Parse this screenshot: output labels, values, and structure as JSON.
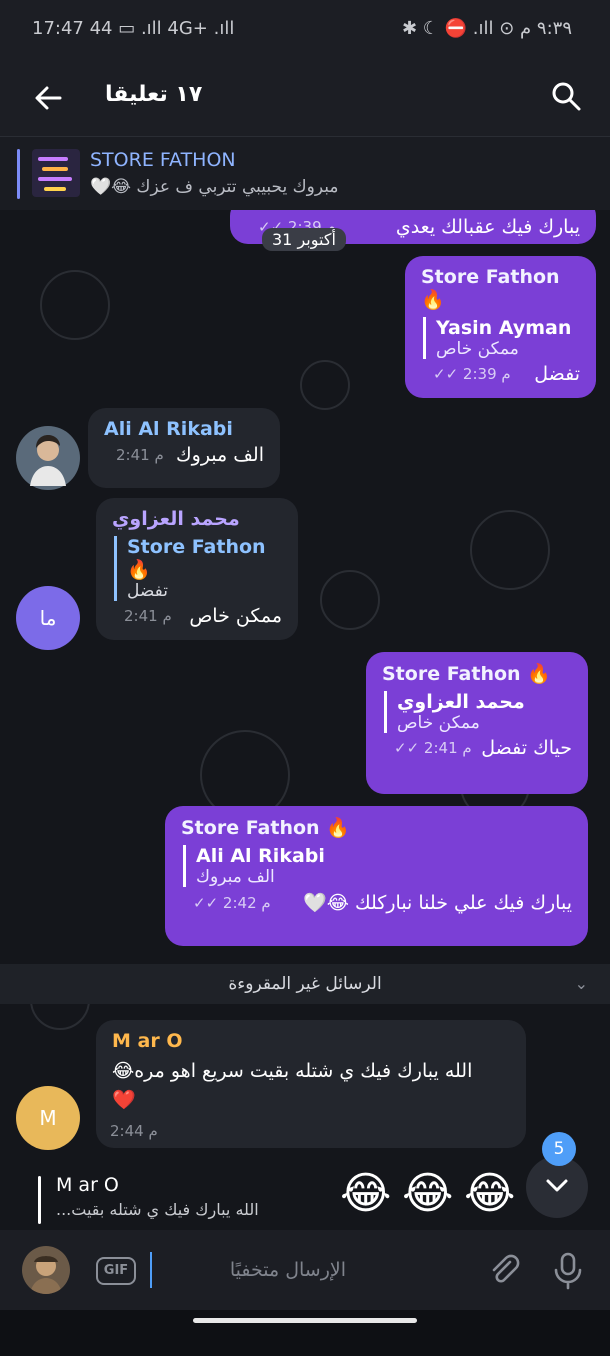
{
  "statusbar": {
    "left": "17:47 44 ▭ .ıll 4G+ .ıll",
    "right": "✱ ☾ ⛔ .ıll ⊙ ٩:٣٩ م"
  },
  "header": {
    "title": "١٧ تعليقا"
  },
  "pinned": {
    "title": "STORE FATHON",
    "text": "مبروك يحبيبي تتربي ف عزك 😂🤍"
  },
  "date_pill": "31 أكتوبر",
  "messages": {
    "m0": {
      "text": "يبارك فيك عقبالك يعدي",
      "time": "2:39 م"
    },
    "m1": {
      "sender": "Store Fathon 🔥",
      "reply_name": "Yasin Ayman",
      "reply_text": "ممكن خاص",
      "text": "تفضل",
      "time": "2:39 م"
    },
    "m2": {
      "sender": "Ali Al Rikabi",
      "text": "الف مبروك",
      "time": "2:41 م"
    },
    "m3": {
      "sender": "محمد العزاوي",
      "avatar": "ما",
      "reply_name": "Store Fathon 🔥",
      "reply_text": "تفضل",
      "text": "ممكن خاص",
      "time": "2:41 م"
    },
    "m4": {
      "sender": "Store Fathon 🔥",
      "reply_name": "محمد العزاوي",
      "reply_text": "ممكن خاص",
      "text": "حياك تفضل",
      "time": "2:41 م"
    },
    "m5": {
      "sender": "Store Fathon 🔥",
      "reply_name": "Ali Al Rikabi",
      "reply_text": "الف مبروك",
      "text": "يبارك فيك علي خلنا نباركلك 😂🤍",
      "time": "2:42 م"
    },
    "m6": {
      "sender": "M ar O",
      "avatar": "M",
      "text": "الله يبارك فيك ي شتله بقيت سريع اهو مره😂",
      "text2": "❤️",
      "time": "2:44 م"
    }
  },
  "unread_label": "الرسائل غير المقروءة",
  "quote_preview": {
    "name": "M ar O",
    "text": "الله يبارك فيك ي شتله بقيت..."
  },
  "quick_emojis": [
    "😂",
    "😂",
    "😂"
  ],
  "unread_count": "5",
  "input": {
    "placeholder": "الإرسال متخفيًا",
    "gif": "GIF"
  },
  "colors": {
    "outgoing": "#7b3fd6",
    "incoming": "#23262d",
    "accent": "#4f9ef8"
  }
}
